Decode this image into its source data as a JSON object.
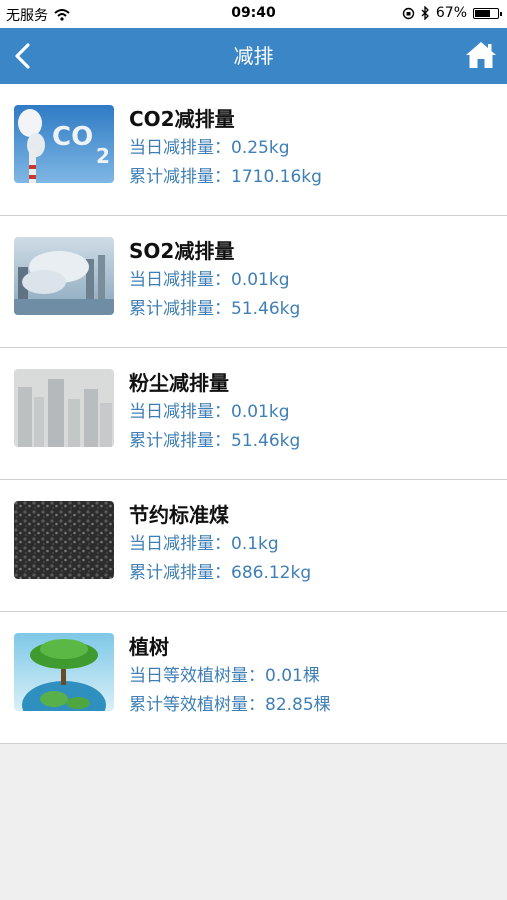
{
  "status": {
    "carrier": "无服务",
    "time": "09:40",
    "battery": "67%",
    "battery_level": 0.67
  },
  "nav": {
    "title": "减排",
    "back_icon": "chevron-left-icon",
    "home_icon": "home-icon"
  },
  "colors": {
    "nav_bg": "#3a86c6",
    "detail_text": "#3f7fb6",
    "page_bg": "#efefef"
  },
  "items": [
    {
      "title": "CO2减排量",
      "line1": "当日减排量：0.25kg",
      "line2": "累计减排量：1710.16kg",
      "image": "co2-smokestack-image"
    },
    {
      "title": "SO2减排量",
      "line1": "当日减排量：0.01kg",
      "line2": "累计减排量：51.46kg",
      "image": "smoggy-factory-image"
    },
    {
      "title": "粉尘减排量",
      "line1": "当日减排量：0.01kg",
      "line2": "累计减排量：51.46kg",
      "image": "dusty-city-image"
    },
    {
      "title": "节约标准煤",
      "line1": "当日减排量：0.1kg",
      "line2": "累计减排量：686.12kg",
      "image": "coal-image"
    },
    {
      "title": "植树",
      "line1": "当日等效植树量：0.01棵",
      "line2": "累计等效植树量：82.85棵",
      "image": "tree-globe-image"
    }
  ]
}
